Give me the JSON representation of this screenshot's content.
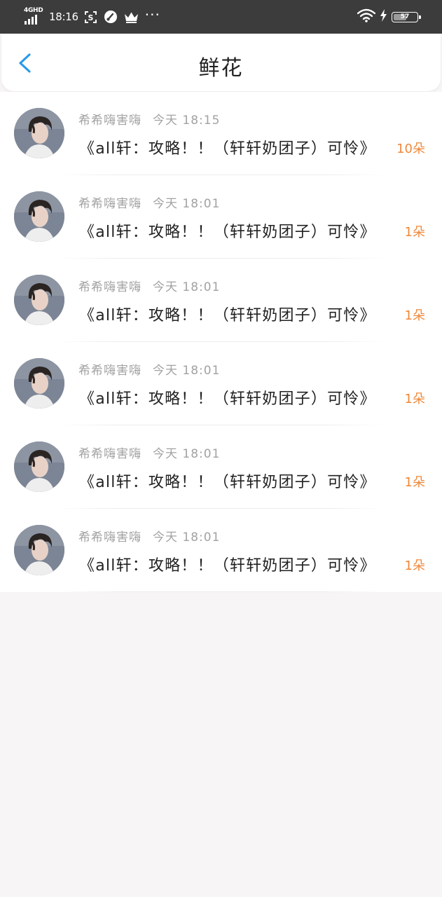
{
  "status_bar": {
    "network": "4GHD",
    "time": "18:16",
    "more": "···",
    "battery": "57",
    "battery_level": 0.57
  },
  "header": {
    "title": "鲜花"
  },
  "colors": {
    "accent_blue": "#2a9be8",
    "count_orange": "#f0883a",
    "meta_gray": "#a2a2a2"
  },
  "items": [
    {
      "username": "希希嗨害嗨",
      "time": "今天 18:15",
      "book_title": "《all轩：攻略！！（轩轩奶团子）可怜》",
      "count": "10朵"
    },
    {
      "username": "希希嗨害嗨",
      "time": "今天 18:01",
      "book_title": "《all轩：攻略！！（轩轩奶团子）可怜》",
      "count": "1朵"
    },
    {
      "username": "希希嗨害嗨",
      "time": "今天 18:01",
      "book_title": "《all轩：攻略！！（轩轩奶团子）可怜》",
      "count": "1朵"
    },
    {
      "username": "希希嗨害嗨",
      "time": "今天 18:01",
      "book_title": "《all轩：攻略！！（轩轩奶团子）可怜》",
      "count": "1朵"
    },
    {
      "username": "希希嗨害嗨",
      "time": "今天 18:01",
      "book_title": "《all轩：攻略！！（轩轩奶团子）可怜》",
      "count": "1朵"
    },
    {
      "username": "希希嗨害嗨",
      "time": "今天 18:01",
      "book_title": "《all轩：攻略！！（轩轩奶团子）可怜》",
      "count": "1朵"
    }
  ]
}
